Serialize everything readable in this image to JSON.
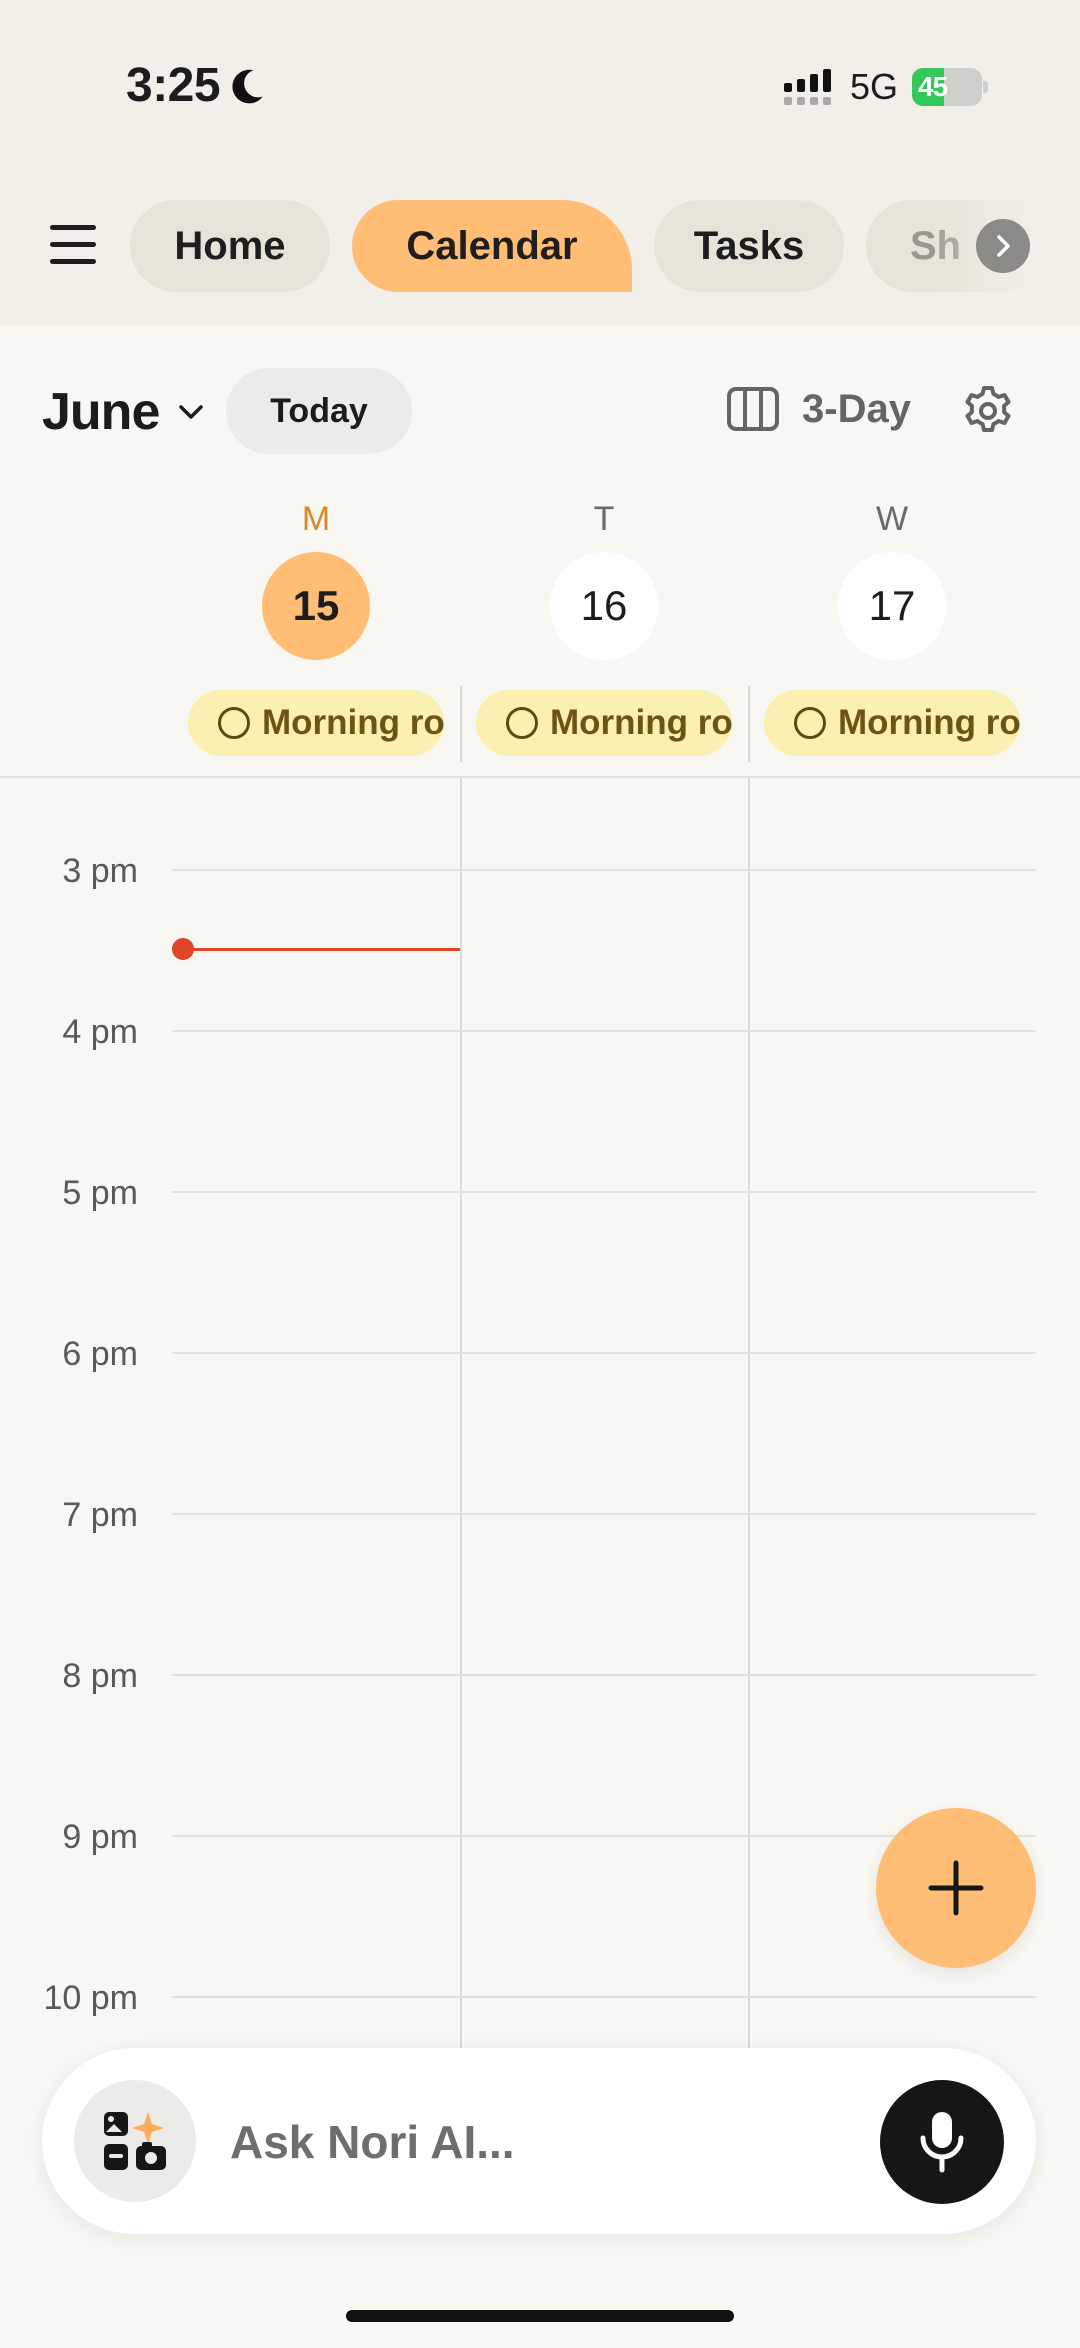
{
  "status_bar": {
    "time": "3:25",
    "network": "5G",
    "battery_level": "45",
    "icons": [
      "moon-icon",
      "signal-icon",
      "battery-icon"
    ]
  },
  "nav": {
    "tabs": [
      {
        "label": "Home",
        "active": false
      },
      {
        "label": "Calendar",
        "active": true
      },
      {
        "label": "Tasks",
        "active": false
      },
      {
        "label": "Sh",
        "active": false
      }
    ],
    "accent_color": "#ffbd75"
  },
  "header": {
    "month": "June",
    "today_label": "Today",
    "view_label": "3-Day"
  },
  "days": [
    {
      "letter": "M",
      "number": "15",
      "selected": true,
      "all_day_event": "Morning ro"
    },
    {
      "letter": "T",
      "number": "16",
      "selected": false,
      "all_day_event": "Morning ro"
    },
    {
      "letter": "W",
      "number": "17",
      "selected": false,
      "all_day_event": "Morning ro"
    }
  ],
  "hours": [
    "3 pm",
    "4 pm",
    "5 pm",
    "6 pm",
    "7 pm",
    "8 pm",
    "9 pm",
    "10 pm"
  ],
  "current_time_indicator": {
    "color": "#e0442a",
    "day": "M"
  },
  "ask_bar": {
    "placeholder": "Ask Nori AI..."
  }
}
